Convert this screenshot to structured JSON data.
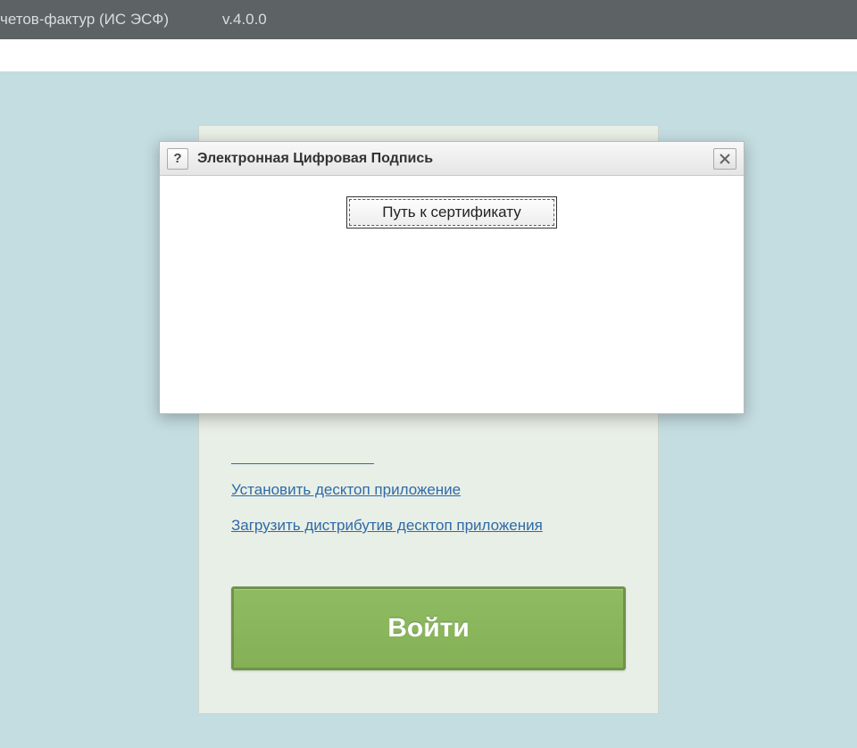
{
  "topbar": {
    "title_fragment": "четов-фактур (ИС ЭСФ)",
    "version": "v.4.0.0"
  },
  "login": {
    "link_install": "Установить десктоп приложение",
    "link_download": "Загрузить дистрибутив десктоп приложения",
    "login_button": "Войти"
  },
  "dialog": {
    "title": "Электронная Цифровая Подпись",
    "help_symbol": "?",
    "cert_path_button": "Путь к сертификату"
  }
}
